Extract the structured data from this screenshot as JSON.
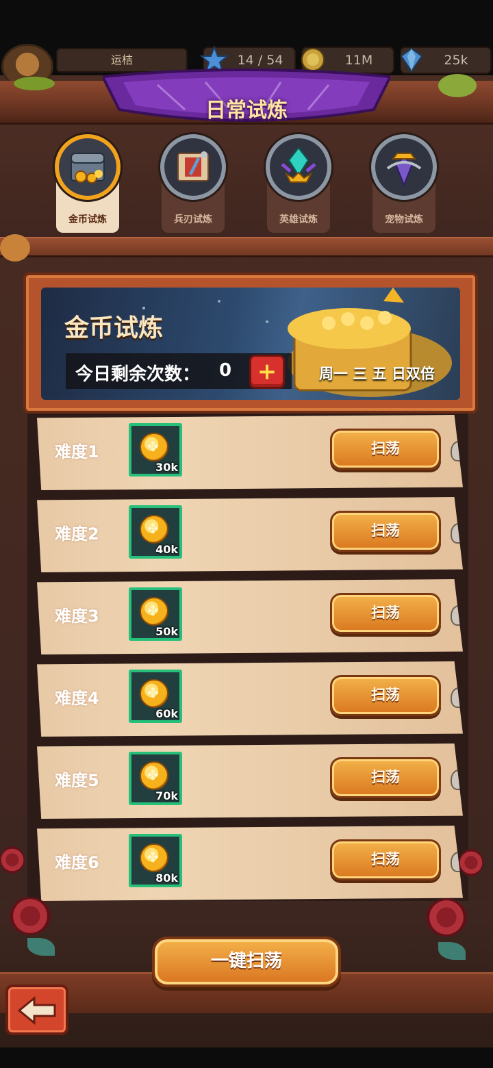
{
  "header": {
    "player_name": "运桔",
    "resources": [
      {
        "icon": "star-icon",
        "value": "14 / 54"
      },
      {
        "icon": "gold-coin-icon",
        "value": "11M"
      },
      {
        "icon": "gem-icon",
        "value": "25k"
      }
    ],
    "title": "日常试炼"
  },
  "tabs": [
    {
      "label": "金币试炼",
      "icon": "treasure-chest-icon",
      "active": true
    },
    {
      "label": "兵刃试炼",
      "icon": "weapon-scroll-icon",
      "active": false
    },
    {
      "label": "英雄试炼",
      "icon": "hero-crystal-icon",
      "active": false
    },
    {
      "label": "宠物试炼",
      "icon": "pet-emblem-icon",
      "active": false
    }
  ],
  "banner": {
    "title": "金币试炼",
    "remaining_label": "今日剩余次数：",
    "remaining_count": "0",
    "add_icon": "plus-icon",
    "double_note": "周一 三 五 日双倍"
  },
  "levels": [
    {
      "label": "难度1",
      "reward": "30k",
      "button": "扫荡"
    },
    {
      "label": "难度2",
      "reward": "40k",
      "button": "扫荡"
    },
    {
      "label": "难度3",
      "reward": "50k",
      "button": "扫荡"
    },
    {
      "label": "难度4",
      "reward": "60k",
      "button": "扫荡"
    },
    {
      "label": "难度5",
      "reward": "70k",
      "button": "扫荡"
    },
    {
      "label": "难度6",
      "reward": "80k",
      "button": "扫荡"
    }
  ],
  "footer": {
    "sweep_all": "一键扫荡",
    "back_icon": "back-arrow-icon"
  },
  "colors": {
    "frame_wood": "#6b3522",
    "ribbon_purple": "#6a2a9e",
    "title_gold": "#ffe3a3",
    "button_orange": "#d9771f",
    "reward_border": "#27c07a",
    "row_parchment": "#efd5b3"
  }
}
